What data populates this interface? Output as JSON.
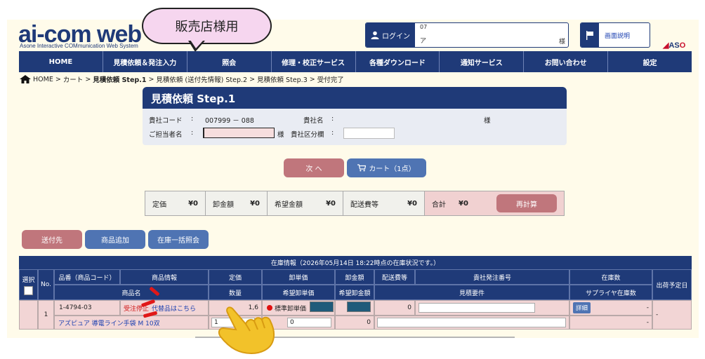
{
  "header": {
    "logo_main": "ai-com web",
    "logo_sub": "Asone Interactive COMmunication Web System",
    "bubble_label": "販売店様用",
    "login_label": "ログイン",
    "login_line1": "07",
    "login_line2": "ア",
    "login_sama": "様",
    "help_label": "画面説明",
    "brand_a": "AS",
    "brand_b": "O"
  },
  "nav": {
    "items": [
      "HOME",
      "見積依頼＆発注入力",
      "照会",
      "修理・校正サービス",
      "各種ダウンロード",
      "通知サービス",
      "お問い合わせ",
      "設定"
    ]
  },
  "breadcrumb": {
    "home": "HOME",
    "sep": ">",
    "cart": "カート",
    "step1": "見積依頼 Step.1",
    "step2": "見積依頼 (送付先情報) Step.2",
    "step3": "見積依頼 Step.3",
    "done": "受付完了"
  },
  "step": {
    "title": "見積依頼 Step.1",
    "company_code_label": "貴社コード",
    "colon": ":",
    "company_code": "007999 － 088",
    "company_name_label": "貴社名",
    "company_name_value": "　",
    "sama": "様",
    "person_label": "ご担当者名",
    "person_value": "",
    "sama2": "様",
    "division_label": "貴社区分欄",
    "division_value": ""
  },
  "actions": {
    "next_label": "次 へ",
    "cart_label": "カート（1点）"
  },
  "totals": {
    "list_price_label": "定価",
    "list_price": "¥0",
    "wholesale_label": "卸金額",
    "wholesale": "¥0",
    "desired_label": "希望金額",
    "desired": "¥0",
    "shipping_label": "配送費等",
    "shipping": "¥0",
    "total_label": "合計",
    "total": "¥0",
    "recalc_label": "再計算"
  },
  "tabs": {
    "ship_label": "送付先",
    "add_label": "商品追加",
    "stock_label": "在庫一括照会"
  },
  "table": {
    "stock_info": "在庫情報（2026年05月14日 18:22時点の在庫状況です。）",
    "headers": {
      "select": "選択",
      "no": "No.",
      "item_code": "品番（商品コード）",
      "item_info": "商品情報",
      "item_name": "商品名",
      "price": "定価",
      "qty": "数量",
      "unit_price": "卸単価",
      "desired_unit": "希望卸単価",
      "wholesale_amt": "卸金額",
      "desired_amt": "希望卸金額",
      "shipping": "配送費等",
      "order_no": "貴社発注番号",
      "quote_req": "見積要件",
      "stock": "在庫数",
      "supplier_stock": "サプライヤ在庫数",
      "ship_date": "出荷予定日"
    },
    "row": {
      "no": "1",
      "code": "1-4794-03",
      "status": "受注停止",
      "alt": "代替品はこちら",
      "name": "アズピュア 導電ライン手袋 M 10双",
      "price": "1,6",
      "qty": "1",
      "std_label": "標準卸単価",
      "desired_unit": "0",
      "wholesale_amt": "0",
      "shipping": "0",
      "detail": "詳細",
      "stock_dash": "-",
      "supplier_dash": "-",
      "ship_date": "-"
    }
  }
}
